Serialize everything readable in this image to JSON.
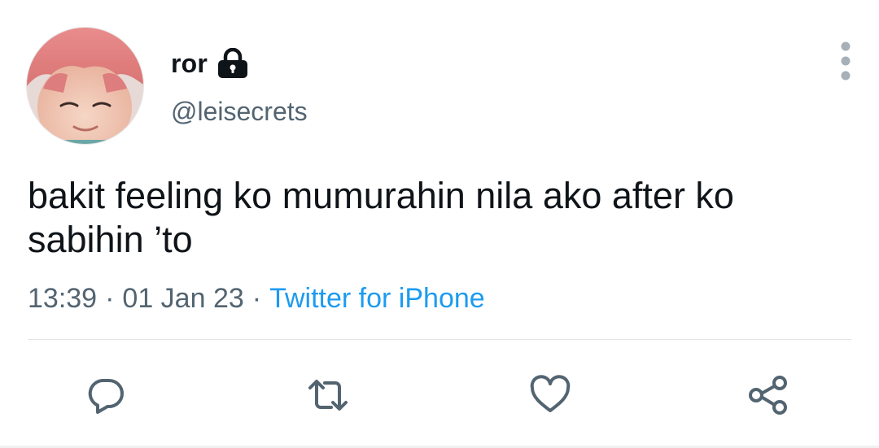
{
  "tweet": {
    "author": {
      "display_name": "ror",
      "handle": "@leisecrets",
      "protected_icon": "lock-icon",
      "avatar": "profile-photo"
    },
    "text": "bakit feeling ko mumurahin nila ako after ko sabihin ’to",
    "time": "13:39",
    "date": "01 Jan 23",
    "separator": "·",
    "source": "Twitter for iPhone"
  },
  "menu_icon": "more-vertical-icon",
  "actions": [
    {
      "name": "reply",
      "icon": "reply-icon"
    },
    {
      "name": "retweet",
      "icon": "retweet-icon"
    },
    {
      "name": "like",
      "icon": "heart-icon"
    },
    {
      "name": "share",
      "icon": "share-icon"
    }
  ],
  "colors": {
    "text": "#0f1419",
    "secondary": "#536471",
    "link": "#1d9bf0",
    "icon": "#536471",
    "divider": "#e5e5e5"
  }
}
